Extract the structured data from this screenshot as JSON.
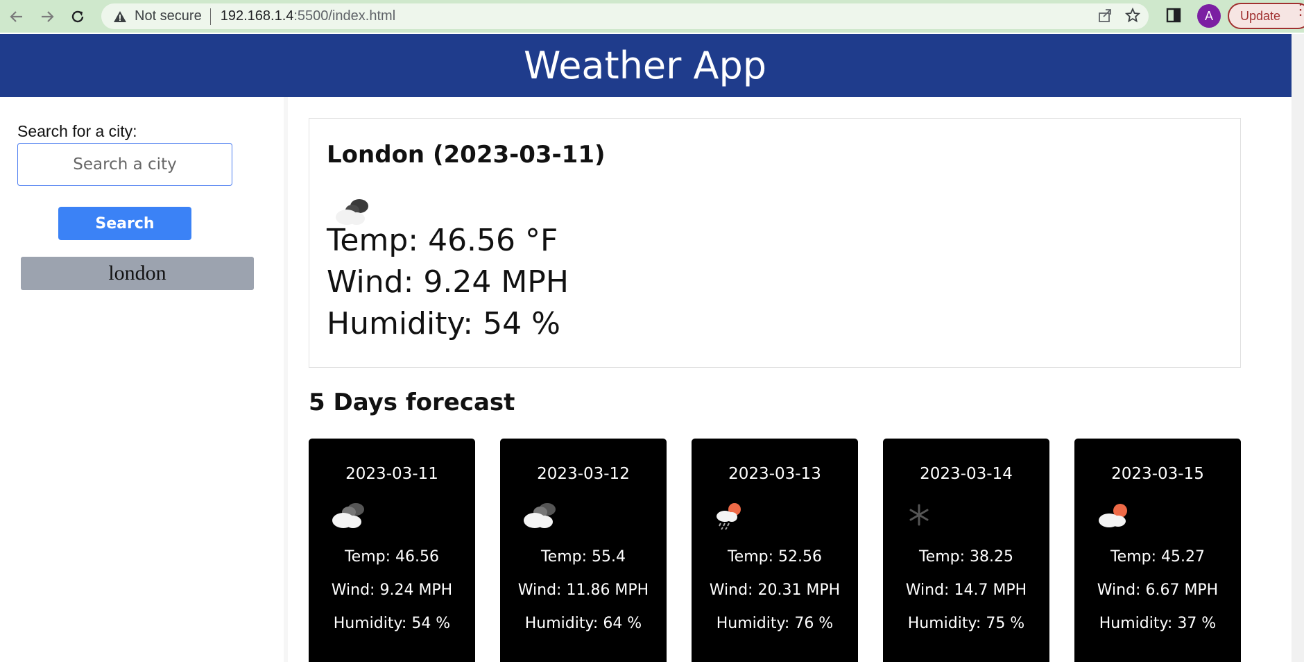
{
  "browser": {
    "not_secure": "Not secure",
    "url_host": "192.168.1.4",
    "url_rest": ":5500/index.html",
    "avatar_letter": "A",
    "update_label": "Update"
  },
  "header": {
    "title": "Weather App"
  },
  "sidebar": {
    "search_label": "Search for a city:",
    "search_placeholder": "Search a city",
    "search_button": "Search",
    "history": [
      "london"
    ]
  },
  "current": {
    "title": "London (2023-03-11)",
    "icon": "broken-clouds-icon",
    "temp": "Temp: 46.56 °F",
    "wind": "Wind: 9.24 MPH",
    "humidity": "Humidity: 54 %"
  },
  "forecast": {
    "title": "5 Days forecast",
    "days": [
      {
        "date": "2023-03-11",
        "icon": "broken-clouds-icon",
        "temp": "Temp: 46.56",
        "wind": "Wind: 9.24 MPH",
        "humidity": "Humidity: 54 %"
      },
      {
        "date": "2023-03-12",
        "icon": "broken-clouds-icon",
        "temp": "Temp: 55.4",
        "wind": "Wind: 11.86 MPH",
        "humidity": "Humidity: 64 %"
      },
      {
        "date": "2023-03-13",
        "icon": "rain-sun-icon",
        "temp": "Temp: 52.56",
        "wind": "Wind: 20.31 MPH",
        "humidity": "Humidity: 76 %"
      },
      {
        "date": "2023-03-14",
        "icon": "snow-icon",
        "temp": "Temp: 38.25",
        "wind": "Wind: 14.7 MPH",
        "humidity": "Humidity: 75 %"
      },
      {
        "date": "2023-03-15",
        "icon": "few-clouds-icon",
        "temp": "Temp: 45.27",
        "wind": "Wind: 6.67 MPH",
        "humidity": "Humidity: 37 %"
      }
    ]
  },
  "colors": {
    "header_bg": "#1f3c8c",
    "search_button": "#3b82f6",
    "history_button": "#9ca3af",
    "card_bg": "#000000"
  }
}
